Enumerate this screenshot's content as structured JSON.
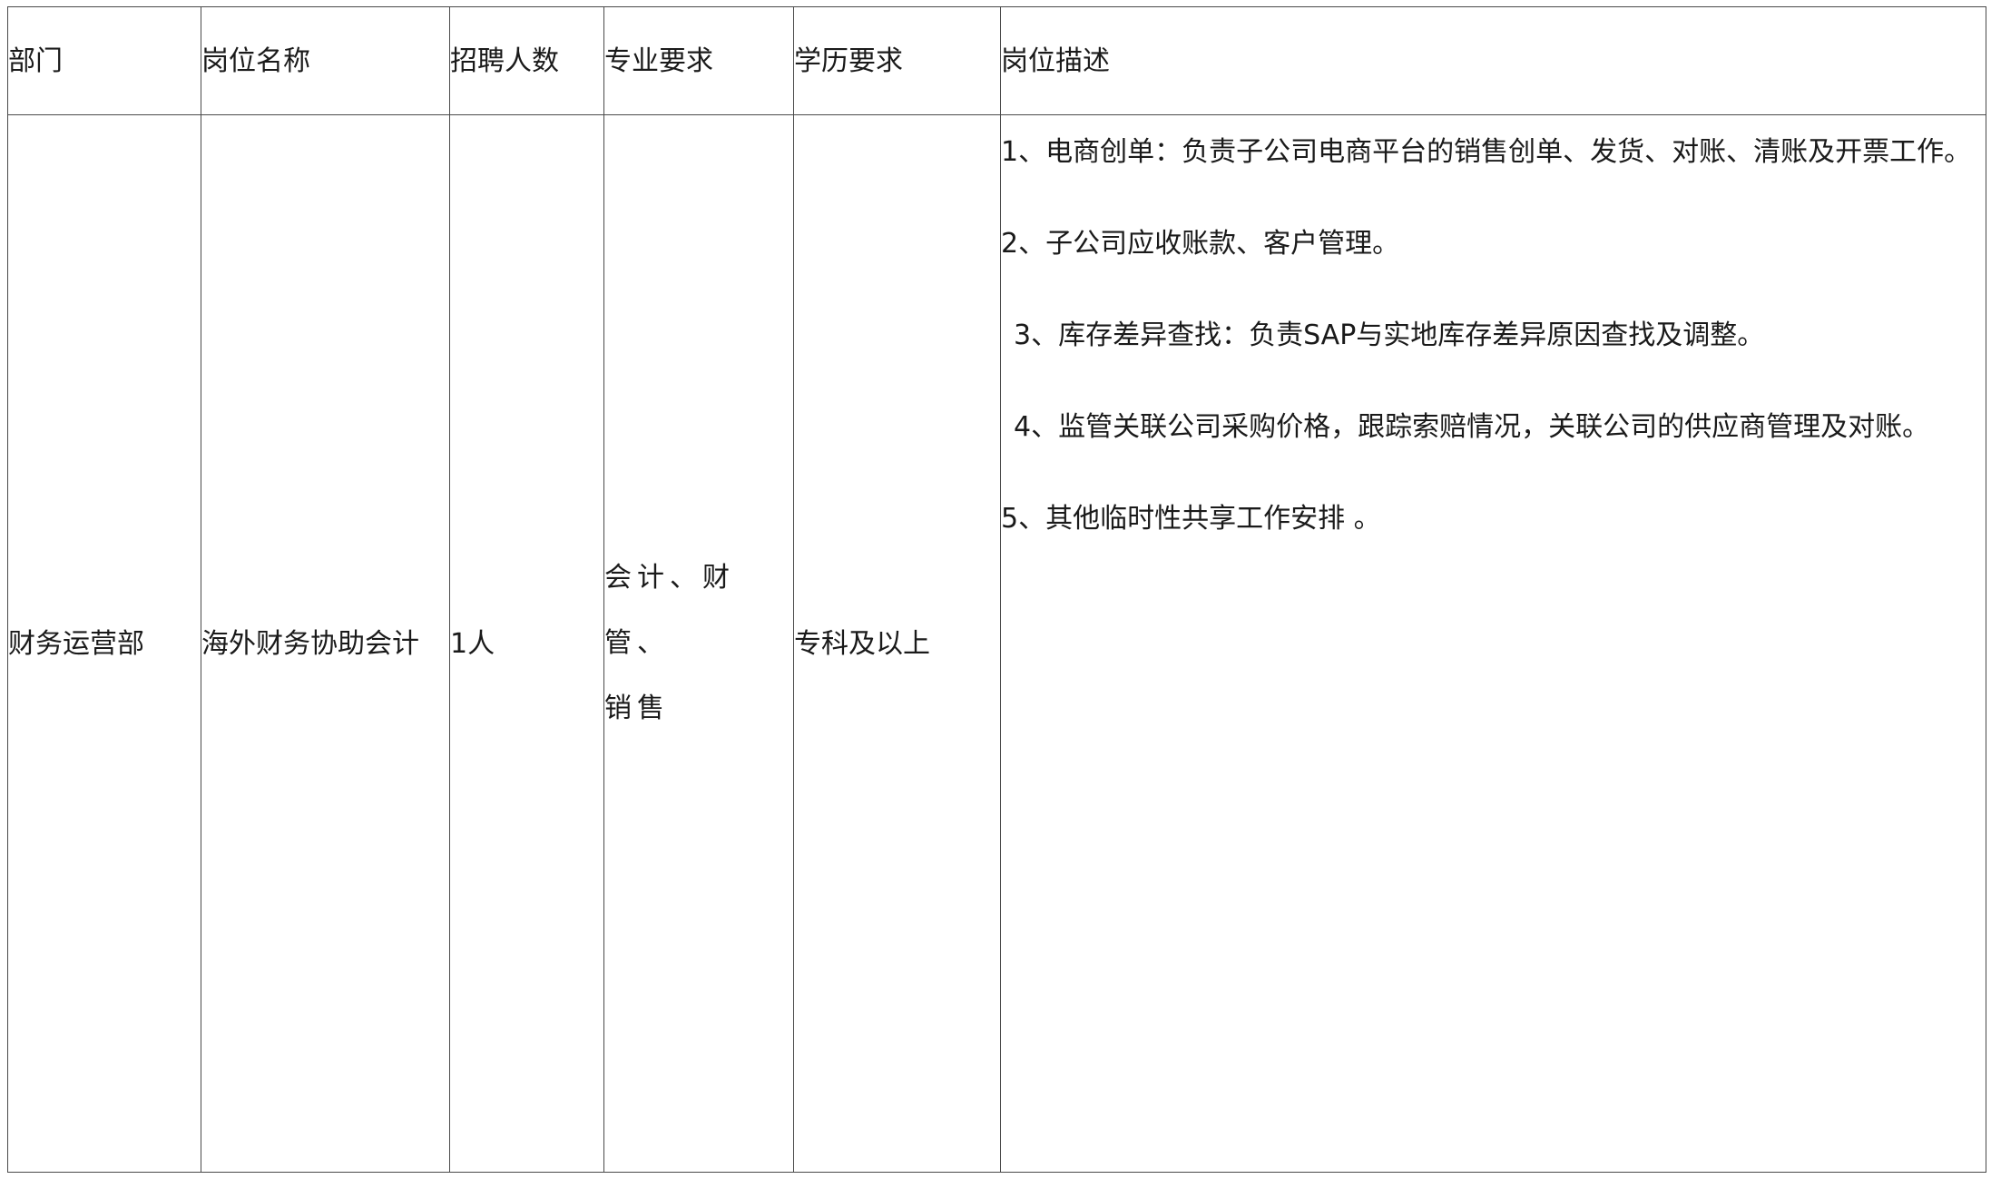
{
  "table": {
    "headers": {
      "department": "部门",
      "position": "岗位名称",
      "headcount": "招聘人数",
      "major": "专业要求",
      "education": "学历要求",
      "description": "岗位描述"
    },
    "row": {
      "department": "财务运营部",
      "position": "海外财务协助会计",
      "headcount": "1人",
      "major_line1": "会计、财管、",
      "major_line2": "销售",
      "education": "专科及以上",
      "description": [
        "1、电商创单：负责子公司电商平台的销售创单、发货、对账、清账及开票工作。",
        "2、子公司应收账款、客户管理。",
        "3、库存差异查找：负责SAP与实地库存差异原因查找及调整。",
        "4、监管关联公司采购价格，跟踪索赔情况，关联公司的供应商管理及对账。",
        "5、其他临时性共享工作安排 。"
      ]
    }
  }
}
